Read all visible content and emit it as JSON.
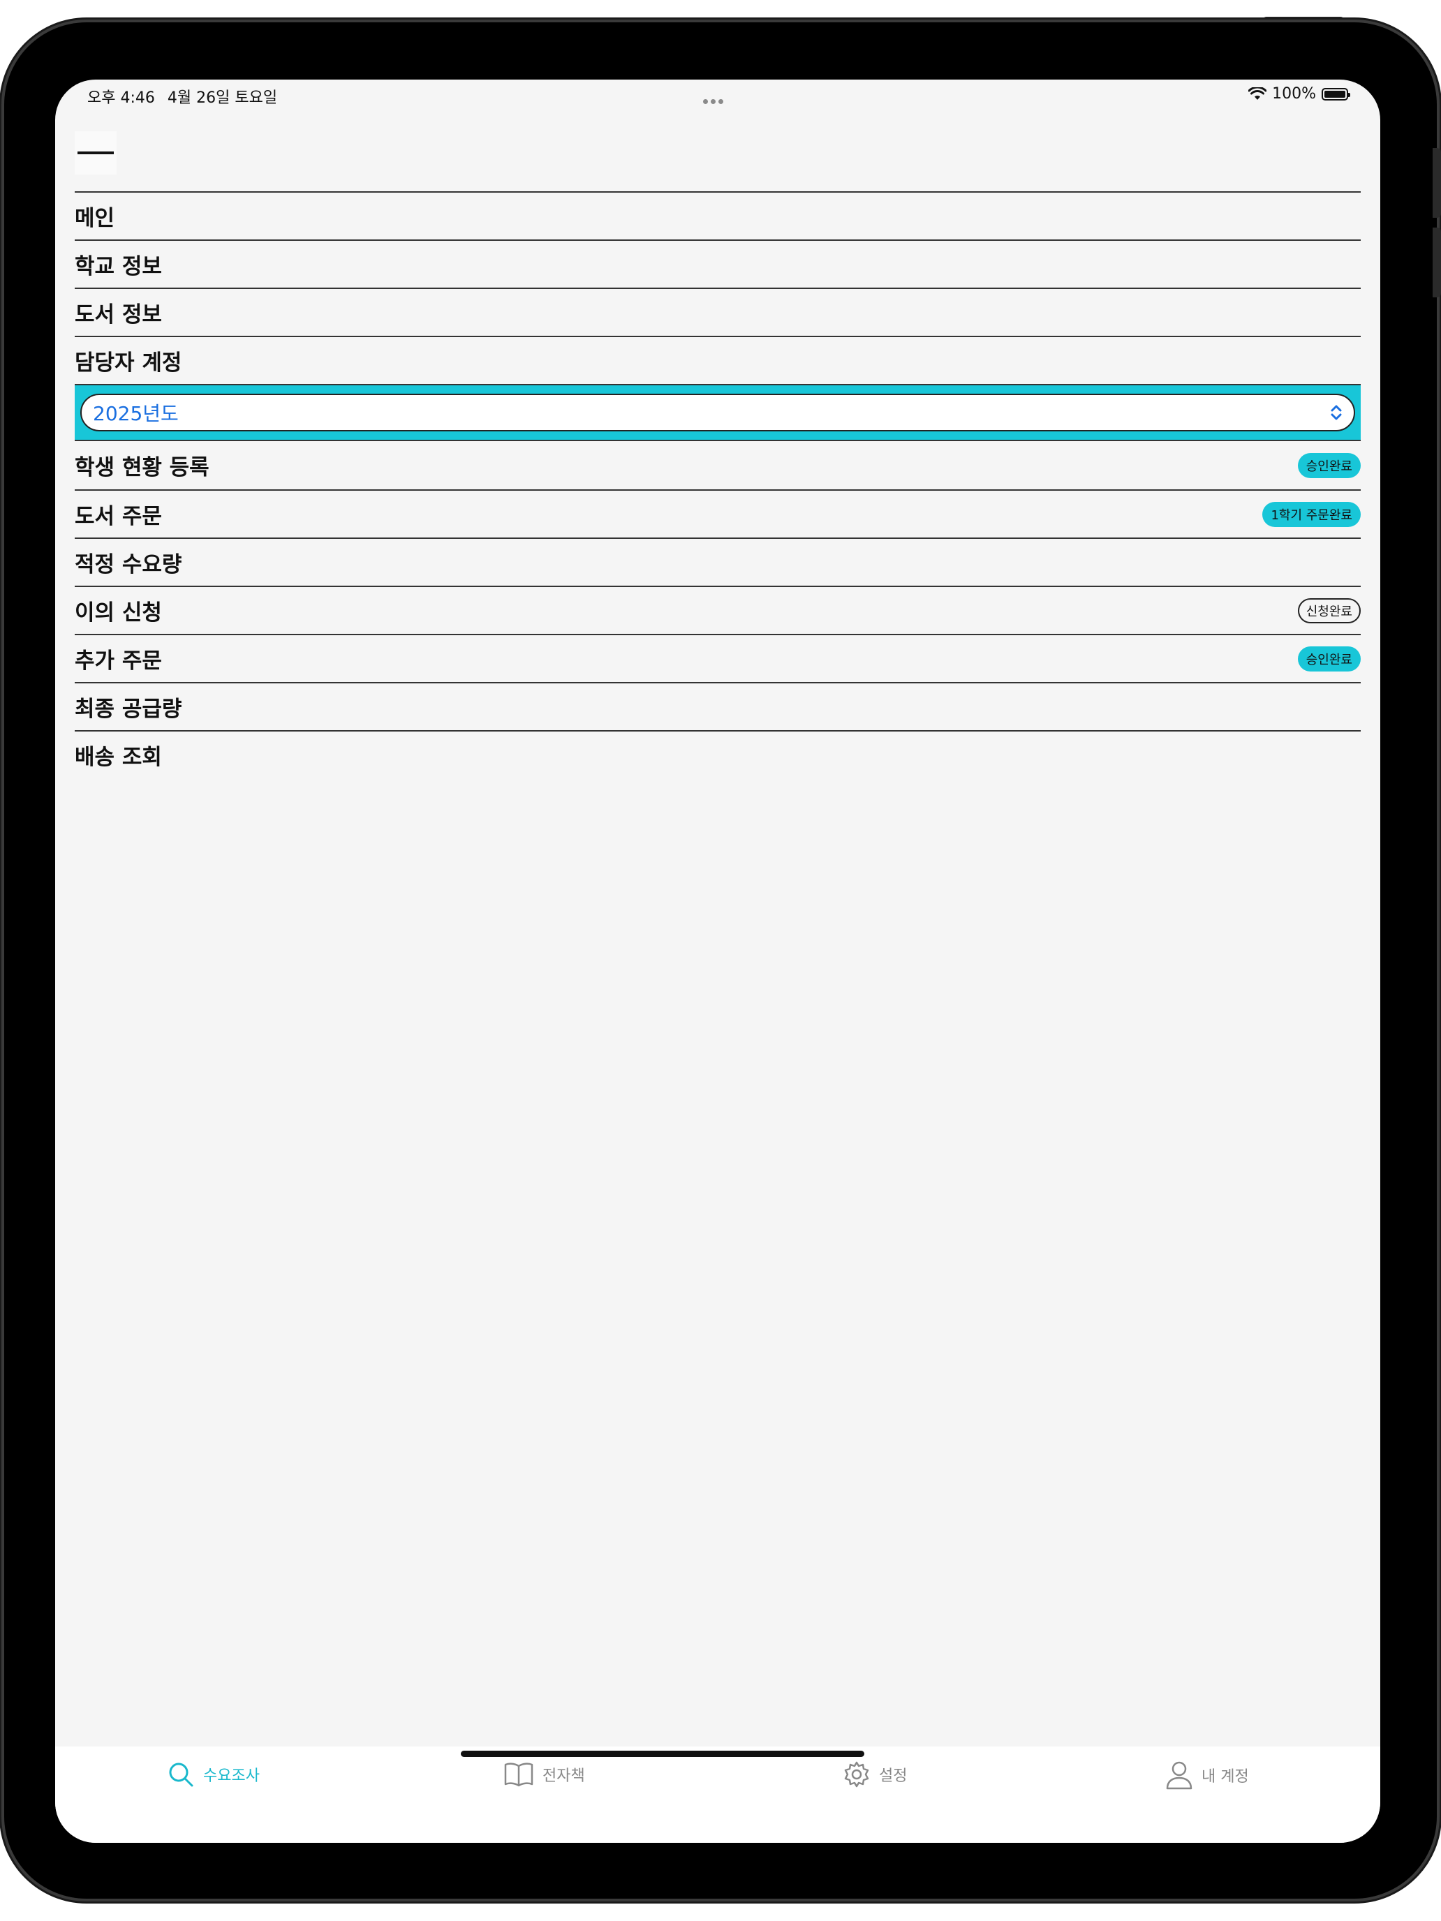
{
  "status": {
    "time": "오후 4:46",
    "date": "4월 26일 토요일",
    "battery": "100%"
  },
  "menu": {
    "items_top": [
      {
        "label": "메인"
      },
      {
        "label": "학교 정보"
      },
      {
        "label": "도서 정보"
      },
      {
        "label": "담당자 계정"
      }
    ],
    "year_select": {
      "value": "2025년도"
    },
    "items_bottom": [
      {
        "label": "학생 현황 등록",
        "badge": "승인완료"
      },
      {
        "label": "도서 주문",
        "badge": "1학기 주문완료"
      },
      {
        "label": "적정 수요량"
      },
      {
        "label": "이의 신청",
        "badge": "신청완료"
      },
      {
        "label": "추가 주문",
        "badge": "승인완료"
      },
      {
        "label": "최종 공급량"
      },
      {
        "label": "배송 조회"
      }
    ]
  },
  "tabbar": {
    "tabs": [
      {
        "label": "수요조사",
        "icon": "search-icon",
        "active": true
      },
      {
        "label": "전자책",
        "icon": "book-icon"
      },
      {
        "label": "설정",
        "icon": "gear-icon"
      },
      {
        "label": "내 계정",
        "icon": "person-icon"
      }
    ]
  },
  "colors": {
    "accent": "#18c6d8",
    "select_text": "#1a6fe0",
    "background": "#f5f5f5"
  }
}
